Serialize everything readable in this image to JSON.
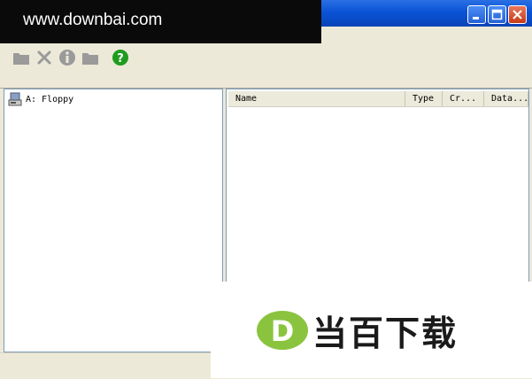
{
  "watermark": {
    "text": "www.downbai.com"
  },
  "window": {
    "buttons": [
      "minimize",
      "maximize",
      "close"
    ]
  },
  "toolbar": {
    "icons": [
      "folder-icon",
      "delete-icon",
      "info-icon",
      "folder-icon",
      "help-icon"
    ],
    "colors": {
      "disabled": "#9a9a9a",
      "help_bg": "#1f9c1f"
    }
  },
  "tree": {
    "items": [
      {
        "label": "A: Floppy",
        "icon": "floppy-drive-icon"
      }
    ]
  },
  "list": {
    "columns": [
      "Name",
      "Type",
      "Cr...",
      "Data..."
    ]
  },
  "brand": {
    "logo_letter": "D",
    "text": "当百下载",
    "colors": {
      "logo": "#8ac43f"
    }
  }
}
